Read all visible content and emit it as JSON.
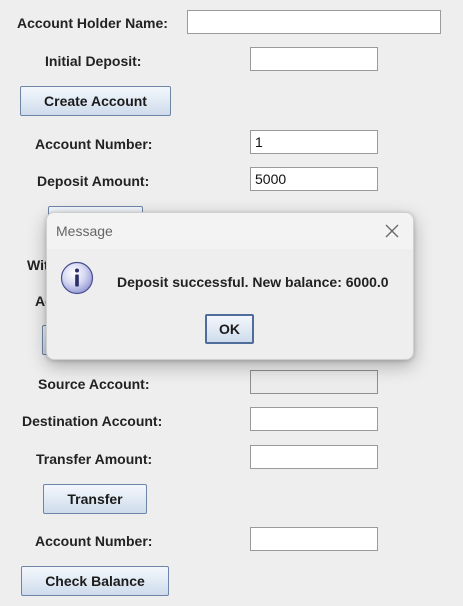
{
  "form": {
    "holder_name_label": "Account Holder Name:",
    "holder_name_value": "",
    "initial_deposit_label": "Initial Deposit:",
    "initial_deposit_value": "",
    "create_account_button": "Create Account",
    "deposit_account_number_label": "Account Number:",
    "deposit_account_number_value": "1",
    "deposit_amount_label": "Deposit Amount:",
    "deposit_amount_value": "5000",
    "withdraw_label_partial": "Wit",
    "withdraw_account_label_partial": "Ac",
    "source_account_label": "Source Account:",
    "source_account_value": "",
    "destination_account_label": "Destination Account:",
    "destination_account_value": "",
    "transfer_amount_label": "Transfer Amount:",
    "transfer_amount_value": "",
    "transfer_button": "Transfer",
    "balance_account_number_label": "Account Number:",
    "balance_account_number_value": "",
    "check_balance_button": "Check Balance"
  },
  "dialog": {
    "title": "Message",
    "message": "Deposit successful. New balance: 6000.0",
    "ok_button": "OK",
    "icon": "info-icon",
    "close_icon": "close-icon"
  }
}
